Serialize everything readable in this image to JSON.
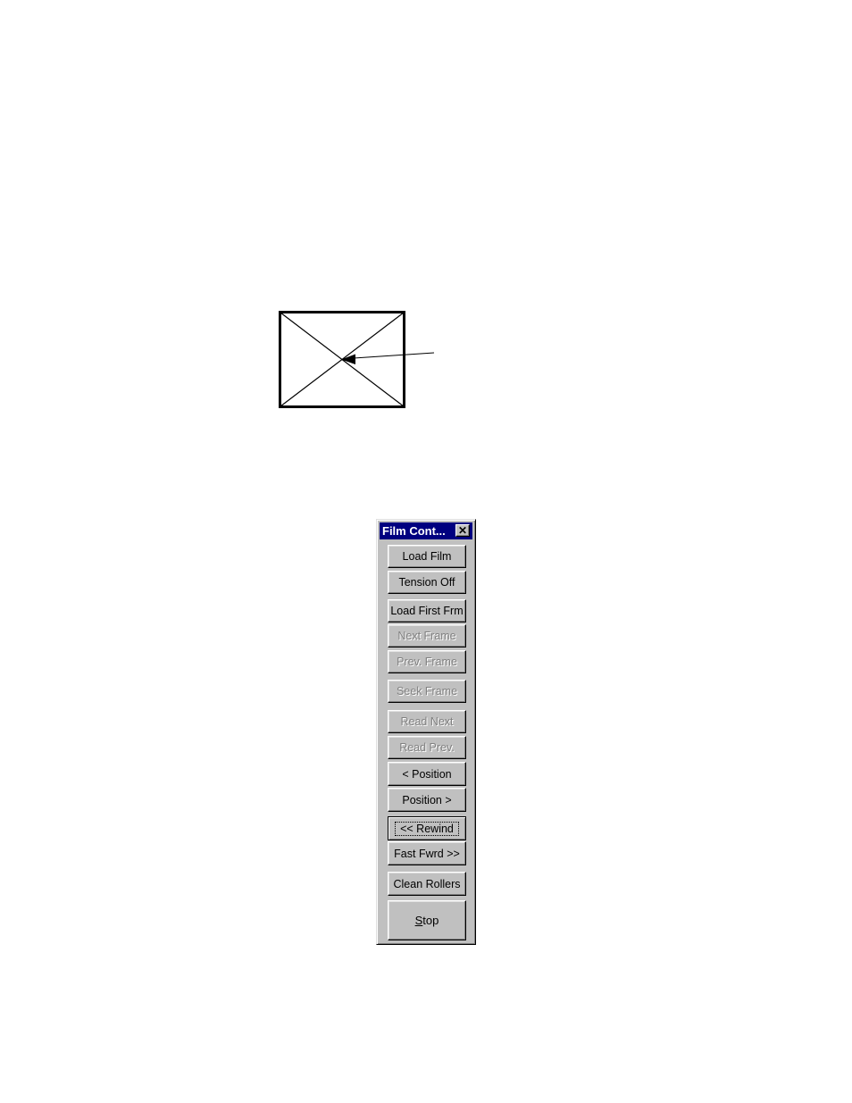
{
  "placeholder_figure": {
    "shape": "crossed-rectangle",
    "arrow_direction": "left",
    "label": ""
  },
  "palette": {
    "title": "Film Cont...",
    "close_label": "✕",
    "buttons": [
      {
        "label": "Load Film",
        "enabled": true
      },
      {
        "label": "Tension Off",
        "enabled": true
      },
      {
        "label": "Load First Frm",
        "enabled": true
      },
      {
        "label": "Next Frame",
        "enabled": false
      },
      {
        "label": "Prev. Frame",
        "enabled": false
      },
      {
        "label": "Seek Frame",
        "enabled": false
      },
      {
        "label": "Read Next",
        "enabled": false
      },
      {
        "label": "Read Prev.",
        "enabled": false
      },
      {
        "label": "< Position",
        "enabled": true
      },
      {
        "label": "Position >",
        "enabled": true
      },
      {
        "label": "<< Rewind",
        "enabled": true,
        "focused": true
      },
      {
        "label": "Fast Fwrd >>",
        "enabled": true
      },
      {
        "label": "Clean Rollers",
        "enabled": true
      },
      {
        "label": "Stop",
        "enabled": true,
        "mnemonic": "S"
      }
    ]
  }
}
